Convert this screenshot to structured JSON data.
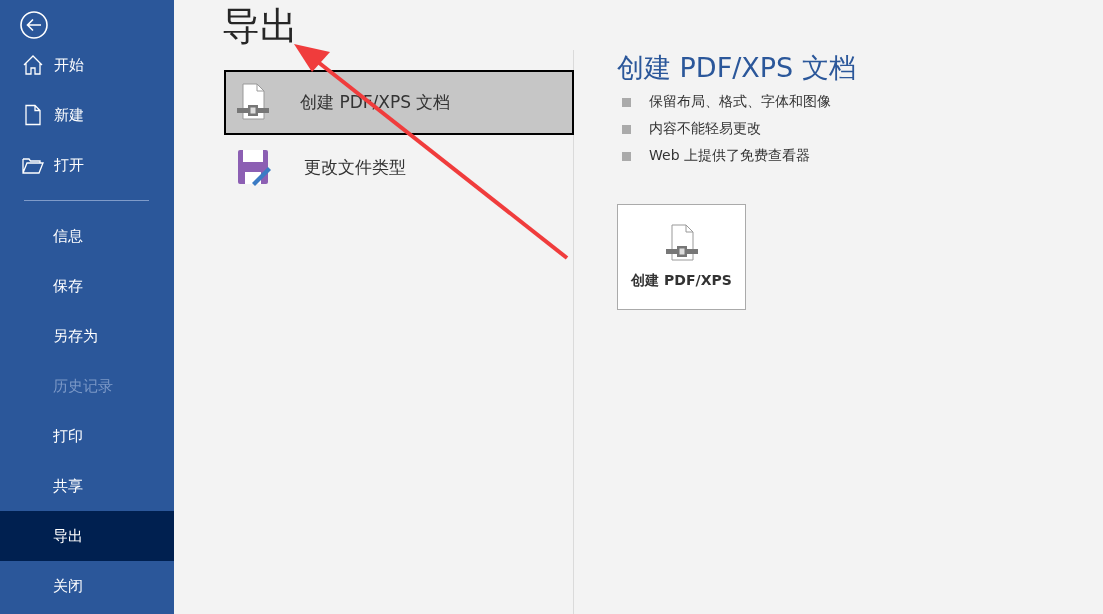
{
  "sidebar": {
    "items": [
      {
        "label": "开始",
        "kind": "home",
        "selected": false,
        "disabled": false
      },
      {
        "label": "新建",
        "kind": "file",
        "selected": false,
        "disabled": false
      },
      {
        "label": "打开",
        "kind": "folder",
        "selected": false,
        "disabled": false
      },
      {
        "label": "信息",
        "kind": "plain",
        "selected": false,
        "disabled": false
      },
      {
        "label": "保存",
        "kind": "plain",
        "selected": false,
        "disabled": false
      },
      {
        "label": "另存为",
        "kind": "plain",
        "selected": false,
        "disabled": false
      },
      {
        "label": "历史记录",
        "kind": "plain",
        "selected": false,
        "disabled": true
      },
      {
        "label": "打印",
        "kind": "plain",
        "selected": false,
        "disabled": false
      },
      {
        "label": "共享",
        "kind": "plain",
        "selected": false,
        "disabled": false
      },
      {
        "label": "导出",
        "kind": "plain",
        "selected": true,
        "disabled": false
      },
      {
        "label": "关闭",
        "kind": "plain",
        "selected": false,
        "disabled": false
      }
    ]
  },
  "page_title": "导出",
  "options": [
    {
      "label": "创建 PDF/XPS 文档",
      "kind": "pdf",
      "selected": true
    },
    {
      "label": "更改文件类型",
      "kind": "filetype",
      "selected": false
    }
  ],
  "detail": {
    "title": "创建 PDF/XPS 文档",
    "bullets": [
      "保留布局、格式、字体和图像",
      "内容不能轻易更改",
      "Web 上提供了免费查看器"
    ],
    "button": "创建 PDF/XPS"
  },
  "annotation": {
    "kind": "arrow"
  }
}
